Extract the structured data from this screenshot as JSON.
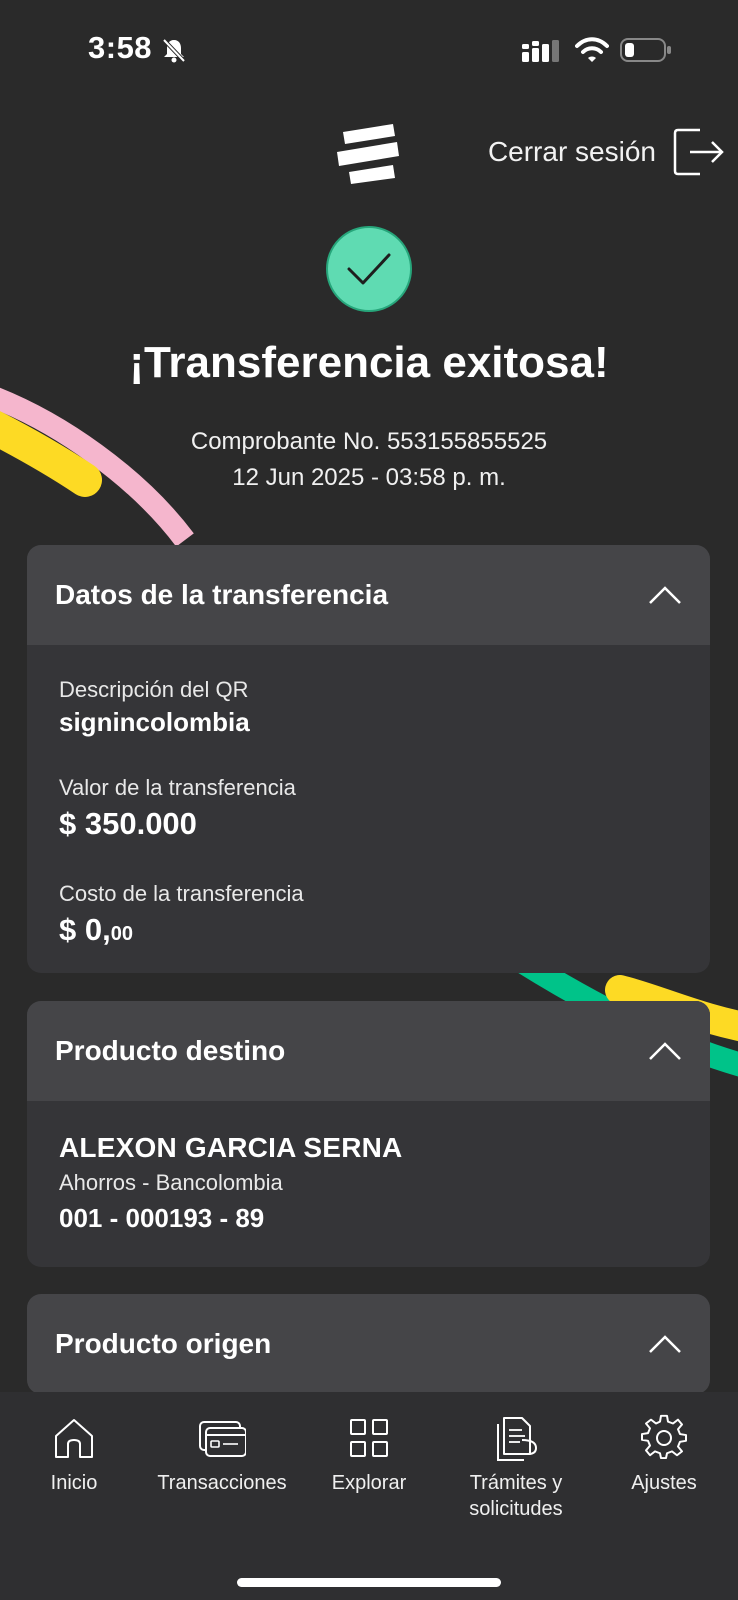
{
  "status_bar": {
    "time": "3:58",
    "icons": [
      "bell-off-icon",
      "signal-icon",
      "wifi-icon",
      "battery-icon"
    ]
  },
  "header": {
    "logo": "bancolombia-logo-icon",
    "logout_label": "Cerrar sesión",
    "logout_icon": "logout-icon"
  },
  "success": {
    "icon": "check-circle-icon",
    "title": "¡Transferencia exitosa!",
    "receipt_line": "Comprobante No. 553155855525",
    "datetime": "12 Jun 2025 - 03:58 p. m."
  },
  "transfer_card": {
    "title": "Datos de la transferencia",
    "fields": [
      {
        "label": "Descripción del QR",
        "value": "signincolombia"
      },
      {
        "label": "Valor de la transferencia",
        "value": "$ 350.000"
      },
      {
        "label": "Costo de la transferencia",
        "value": "$ 0,",
        "cents": "00"
      }
    ]
  },
  "destination_card": {
    "title": "Producto destino",
    "name": "ALEXON GARCIA SERNA",
    "account_type": "Ahorros - Bancolombia",
    "account_number": "001 - 000193 - 89"
  },
  "origin_card": {
    "title": "Producto origen"
  },
  "bottom_nav": [
    {
      "label": "Inicio",
      "icon": "home-icon"
    },
    {
      "label": "Transacciones",
      "icon": "card-icon"
    },
    {
      "label": "Explorar",
      "icon": "grid-icon"
    },
    {
      "label": "Trámites y solicitudes",
      "icon": "document-icon"
    },
    {
      "label": "Ajustes",
      "icon": "gear-icon"
    }
  ],
  "colors": {
    "background": "#2a2a2a",
    "card": "#353538",
    "card_header": "#454548",
    "success_green": "#5fdbb2",
    "accent_yellow": "#fdda24",
    "accent_pink": "#f5b6cd",
    "accent_green": "#00c389"
  }
}
